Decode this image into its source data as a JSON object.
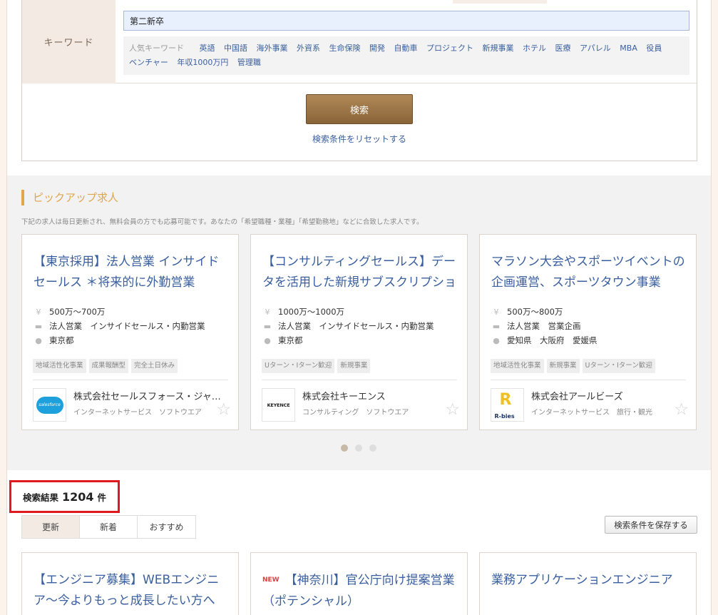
{
  "search_form": {
    "keyword_label": "キーワード",
    "keyword_value": "第二新卒",
    "popular_title": "人気キーワード",
    "popular_keywords": [
      "英語",
      "中国語",
      "海外事業",
      "外資系",
      "生命保険",
      "開発",
      "自動車",
      "プロジェクト",
      "新規事業",
      "ホテル",
      "医療",
      "アパレル",
      "MBA",
      "役員",
      "ベンチャー",
      "年収1000万円",
      "管理職"
    ],
    "search_button": "検索",
    "reset_link": "検索条件をリセットする"
  },
  "pickup": {
    "heading": "ピックアップ求人",
    "description": "下記の求人は毎日更新され、無料会員の方でも応募可能です。あなたの「希望職種・業種」「希望勤務地」などに合致した求人です。",
    "cards": [
      {
        "title": "【東京採用】法人営業 インサイドセールス ＊将来的に外勤営業",
        "salary": "500万～700万",
        "job_type": "法人営業　インサイドセールス・内勤営業",
        "location": "東京都",
        "tags": [
          "地域活性化事業",
          "成果報酬型",
          "完全土日休み"
        ],
        "company": "株式会社セールスフォース・ジャパン",
        "industry": "インターネットサービス　ソフトウエア",
        "logo_text": "salesforce"
      },
      {
        "title": "【コンサルティングセールス】データを活用した新規サブスクリプション",
        "salary": "1000万～1000万",
        "job_type": "法人営業　インサイドセールス・内勤営業",
        "location": "東京都",
        "tags": [
          "Uターン・Iターン歓迎",
          "新規事業"
        ],
        "company": "株式会社キーエンス",
        "industry": "コンサルティング　ソフトウエア",
        "logo_text": "KEYENCE"
      },
      {
        "title": "マラソン大会やスポーツイベントの企画運営、スポーツタウン事業",
        "salary": "500万～800万",
        "job_type": "法人営業　営業企画",
        "location": "愛知県　大阪府　愛媛県",
        "tags": [
          "地域活性化事業",
          "新規事業",
          "Uターン・Iターン歓迎"
        ],
        "company": "株式会社アールビーズ",
        "industry": "インターネットサービス　旅行・観光",
        "logo_text": "R-bies"
      }
    ]
  },
  "results": {
    "label": "検索結果",
    "count": "1204",
    "unit": "件",
    "sort_tabs": [
      "更新",
      "新着",
      "おすすめ"
    ],
    "active_sort": "更新",
    "save_button": "検索条件を保存する",
    "cards": [
      {
        "title": "【エンジニア募集】WEBエンジニア～今よりもっと成長したい方へ",
        "is_new": false
      },
      {
        "title": "【神奈川】官公庁向け提案営業（ポテンシャル）",
        "is_new": true,
        "new_label": "NEW"
      },
      {
        "title": "業務アプリケーションエンジニア",
        "is_new": false
      }
    ]
  },
  "icons": {
    "salary": "yen-icon",
    "job_type": "briefcase-icon",
    "location": "map-pin-icon",
    "favorite": "star-icon"
  },
  "colors": {
    "accent": "#e0a64c",
    "link": "#3a5f9f",
    "button": "#8a6439",
    "highlight": "#e0181f"
  }
}
